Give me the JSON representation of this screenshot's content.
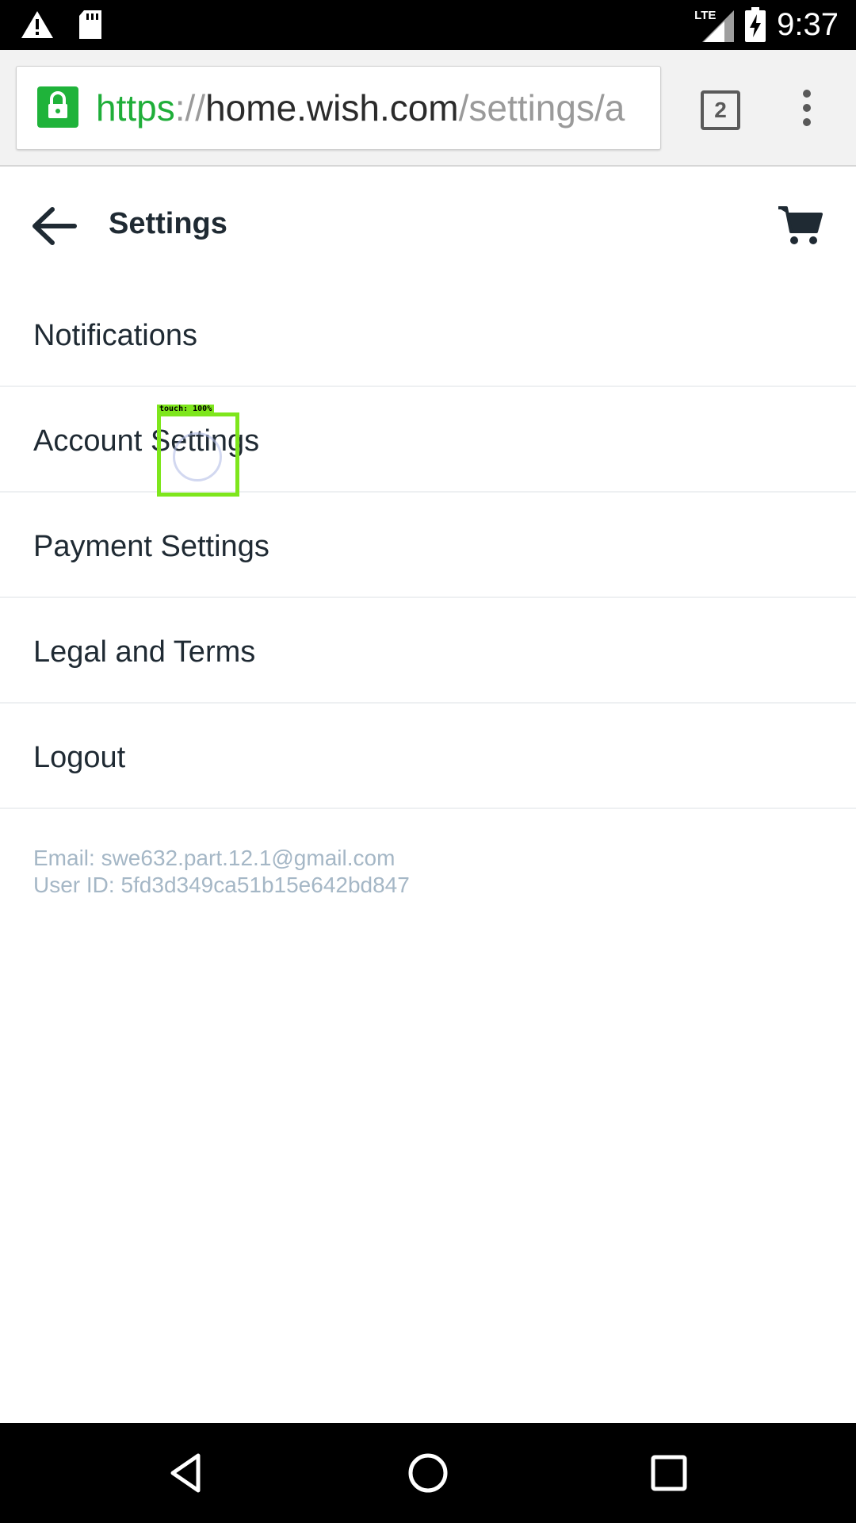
{
  "status_bar": {
    "time": "9:37",
    "network": "LTE",
    "icons": [
      "warning-icon",
      "sd-card-icon",
      "signal-icon",
      "battery-charging-icon"
    ]
  },
  "browser": {
    "url_scheme": "https",
    "url_sep": "://",
    "url_host": "home.wish.com",
    "url_path": "/settings/a",
    "tab_count": "2",
    "icons": [
      "lock-icon",
      "more-vert-icon"
    ]
  },
  "header": {
    "title": "Settings",
    "icons": [
      "back-arrow-icon",
      "cart-icon"
    ]
  },
  "settings": {
    "items": [
      {
        "label": "Notifications"
      },
      {
        "label": "Account Settings"
      },
      {
        "label": "Payment Settings"
      },
      {
        "label": "Legal and Terms"
      },
      {
        "label": "Logout"
      }
    ]
  },
  "account": {
    "email_line": "Email: swe632.part.12.1@gmail.com",
    "user_id_line": "User ID: 5fd3d349ca51b15e642bd847"
  },
  "touch_overlay": {
    "label": "touch: 100%",
    "color": "#7ee61c"
  },
  "nav_bar": {
    "icons": [
      "back-triangle-icon",
      "home-circle-icon",
      "recents-square-icon"
    ]
  },
  "colors": {
    "accent_green": "#1fb33a",
    "text_dark": "#1f2a33",
    "muted_blue_gray": "#a5b7c6"
  }
}
